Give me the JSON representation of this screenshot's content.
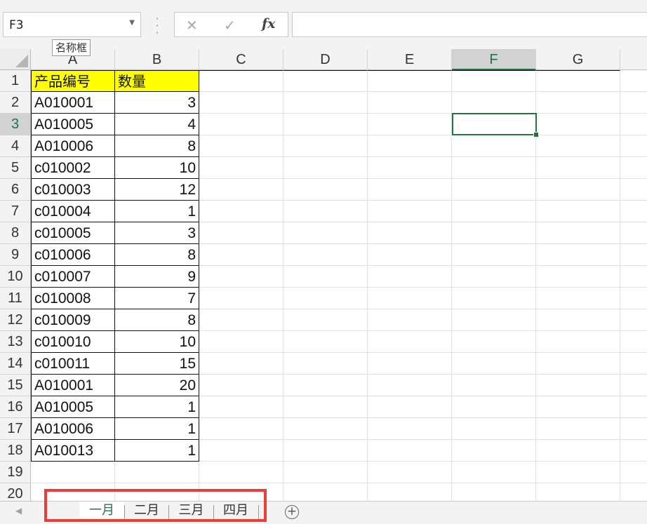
{
  "namebox": {
    "value": "F3",
    "tooltip": "名称框"
  },
  "formula_bar": {
    "cancel_icon": "✕",
    "enter_icon": "✓",
    "fx_label": "fx",
    "value": ""
  },
  "columns": [
    "A",
    "B",
    "C",
    "D",
    "E",
    "F",
    "G"
  ],
  "selected_column": "F",
  "selected_row": "3",
  "rows": [
    {
      "num": "1",
      "a": "产品编号",
      "b": "数量"
    },
    {
      "num": "2",
      "a": "A010001",
      "b": "3"
    },
    {
      "num": "3",
      "a": "A010005",
      "b": "4"
    },
    {
      "num": "4",
      "a": "A010006",
      "b": "8"
    },
    {
      "num": "5",
      "a": "c010002",
      "b": "10"
    },
    {
      "num": "6",
      "a": "c010003",
      "b": "12"
    },
    {
      "num": "7",
      "a": "c010004",
      "b": "1"
    },
    {
      "num": "8",
      "a": "c010005",
      "b": "3"
    },
    {
      "num": "9",
      "a": "c010006",
      "b": "8"
    },
    {
      "num": "10",
      "a": "c010007",
      "b": "9"
    },
    {
      "num": "11",
      "a": "c010008",
      "b": "7"
    },
    {
      "num": "12",
      "a": "c010009",
      "b": "8"
    },
    {
      "num": "13",
      "a": "c010010",
      "b": "10"
    },
    {
      "num": "14",
      "a": "c010011",
      "b": "15"
    },
    {
      "num": "15",
      "a": "A010001",
      "b": "20"
    },
    {
      "num": "16",
      "a": "A010005",
      "b": "1"
    },
    {
      "num": "17",
      "a": "A010006",
      "b": "1"
    },
    {
      "num": "18",
      "a": "A010013",
      "b": "1"
    },
    {
      "num": "19",
      "a": "",
      "b": ""
    },
    {
      "num": "20",
      "a": "",
      "b": ""
    }
  ],
  "sheets": [
    {
      "label": "一月",
      "active": true
    },
    {
      "label": "二月",
      "active": false
    },
    {
      "label": "三月",
      "active": false
    },
    {
      "label": "四月",
      "active": false
    }
  ],
  "add_sheet_icon": "+",
  "colors": {
    "accent": "#217346",
    "header_fill": "#ffff00",
    "highlight_box": "#ee3b3b"
  }
}
